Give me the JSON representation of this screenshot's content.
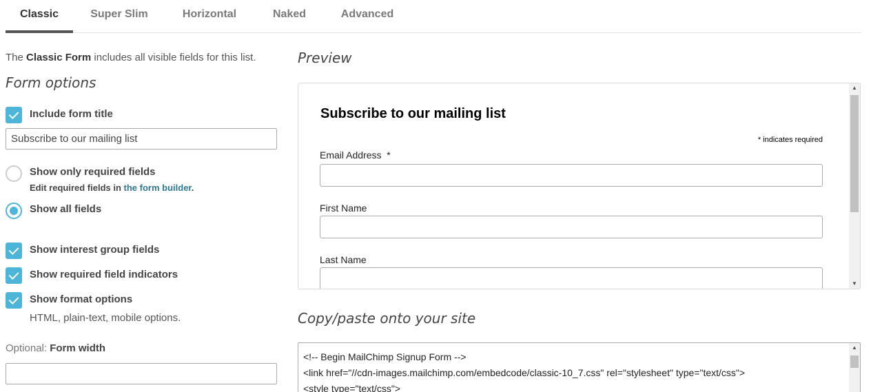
{
  "tabs": [
    {
      "label": "Classic"
    },
    {
      "label": "Super Slim"
    },
    {
      "label": "Horizontal"
    },
    {
      "label": "Naked"
    },
    {
      "label": "Advanced"
    }
  ],
  "intro": {
    "prefix": "The ",
    "bold": "Classic Form",
    "suffix": " includes all visible fields for this list."
  },
  "form_options": {
    "heading": "Form options",
    "include_title": {
      "label": "Include form title",
      "checked": true
    },
    "title_input_value": "Subscribe to our mailing list",
    "required_only": {
      "label": "Show only required fields",
      "selected": false,
      "hint_prefix": "Edit required fields in ",
      "hint_link": "the form builder",
      "hint_suffix": "."
    },
    "all_fields": {
      "label": "Show all fields",
      "selected": true
    },
    "interest_groups": {
      "label": "Show interest group fields",
      "checked": true
    },
    "required_indicators": {
      "label": "Show required field indicators",
      "checked": true
    },
    "format_options": {
      "label": "Show format options",
      "checked": true,
      "hint": "HTML, plain-text, mobile options."
    },
    "width_optional": "Optional:",
    "width_label": "Form width",
    "width_value": ""
  },
  "preview": {
    "heading": "Preview",
    "form_title": "Subscribe to our mailing list",
    "required_note_star": "*",
    "required_note": "indicates required",
    "fields": [
      {
        "label": "Email Address",
        "required_mark": "*"
      },
      {
        "label": "First Name",
        "required_mark": ""
      },
      {
        "label": "Last Name",
        "required_mark": ""
      }
    ]
  },
  "copy": {
    "heading": "Copy/paste onto your site",
    "code_lines": [
      "<!-- Begin MailChimp Signup Form -->",
      "<link href=\"//cdn-images.mailchimp.com/embedcode/classic-10_7.css\" rel=\"stylesheet\" type=\"text/css\">",
      "<style type=\"text/css\">"
    ]
  },
  "colors": {
    "accent": "#4cb5d8",
    "link": "#2d7790",
    "tab_active": "#555555"
  }
}
